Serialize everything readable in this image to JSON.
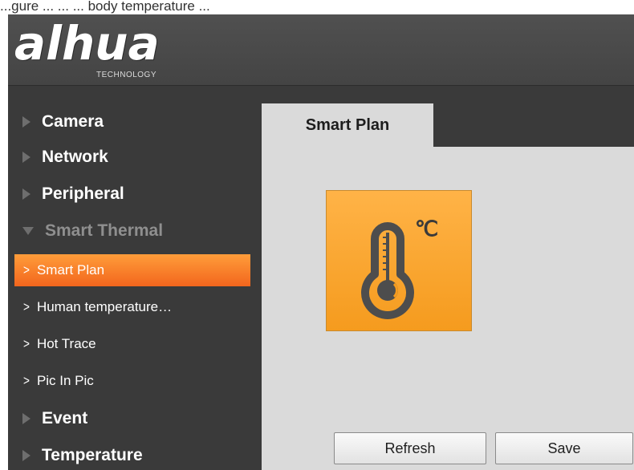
{
  "caption": "...gure ... ... ... body temperature ...",
  "brand": {
    "logo": "alhua",
    "sub": "TECHNOLOGY"
  },
  "sidebar": {
    "items": [
      {
        "label": "Camera"
      },
      {
        "label": "Network"
      },
      {
        "label": "Peripheral"
      },
      {
        "label": "Smart Thermal",
        "expanded": true
      }
    ],
    "sub_items": [
      {
        "label": "Smart Plan",
        "active": true
      },
      {
        "label": "Human temperature…"
      },
      {
        "label": "Hot Trace"
      },
      {
        "label": "Pic In Pic"
      }
    ],
    "items_after": [
      {
        "label": "Event"
      },
      {
        "label": "Temperature"
      }
    ]
  },
  "main": {
    "tab": "Smart Plan",
    "tile": {
      "icon": "thermometer-icon",
      "unit": "℃"
    },
    "buttons": {
      "refresh": "Refresh",
      "save": "Save"
    }
  },
  "colors": {
    "accent": "#f59b1e",
    "active_nav": "#f2651d",
    "sidebar_bg": "#3a3a3a",
    "panel_bg": "#dadada"
  }
}
